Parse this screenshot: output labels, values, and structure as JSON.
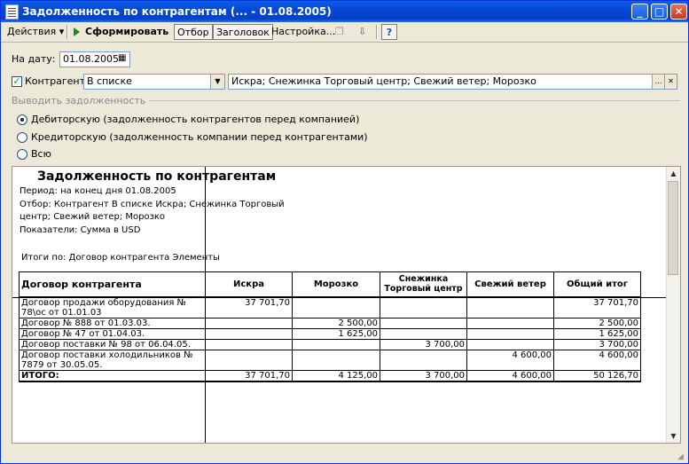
{
  "window": {
    "title": "Задолженность по контрагентам (... - 01.08.2005)"
  },
  "toolbar": {
    "actions_label": "Действия",
    "generate_label": "Сформировать",
    "filter_label": "Отбор",
    "header_label": "Заголовок",
    "settings_label": "Настройка...",
    "help_label": "?"
  },
  "form": {
    "date_label": "На дату:",
    "date_value": "01.08.2005",
    "counterparty_label": "Контрагент:",
    "counterparty_mode": "В списке",
    "counterparty_value": "Искра; Снежинка Торговый центр; Свежий ветер; Морозко",
    "output_section": "Выводить задолженность",
    "option_receivable": "Дебиторскую (задолженность контрагентов перед компанией)",
    "option_payable": "Кредиторскую (задолженность компании перед контрагентами)",
    "option_all": "Всю"
  },
  "report": {
    "title": "Задолженность по контрагентам",
    "period": "Период: на конец дня 01.08.2005",
    "filter_line1": "Отбор: Контрагент В списке Искра; Снежинка Торговый",
    "filter_line2": "центр; Свежий ветер; Морозко",
    "indicators": "Показатели:  Сумма в USD",
    "totals_by": "Итоги по:  Договор контрагента Элементы",
    "headers": [
      "Договор контрагента",
      "Искра",
      "Морозко",
      "Снежинка Торговый центр",
      "Свежий ветер",
      "Общий итог"
    ],
    "rows": [
      [
        "Договор продажи оборудования № 78\\ос от 01.01.03",
        "37 701,70",
        "",
        "",
        "",
        "37 701,70"
      ],
      [
        "Договор № 888 от 01.03.03.",
        "",
        "2 500,00",
        "",
        "",
        "2 500,00"
      ],
      [
        "Договор № 47 от 01.04.03.",
        "",
        "1 625,00",
        "",
        "",
        "1 625,00"
      ],
      [
        "Договор поставки № 98 от 06.04.05.",
        "",
        "",
        "3 700,00",
        "",
        "3 700,00"
      ],
      [
        "Договор поставки холодильников № 7879 от 30.05.05.",
        "",
        "",
        "",
        "4 600,00",
        "4 600,00"
      ],
      [
        "ИТОГО:",
        "37 701,70",
        "4 125,00",
        "3 700,00",
        "4 600,00",
        "50 126,70"
      ]
    ]
  }
}
